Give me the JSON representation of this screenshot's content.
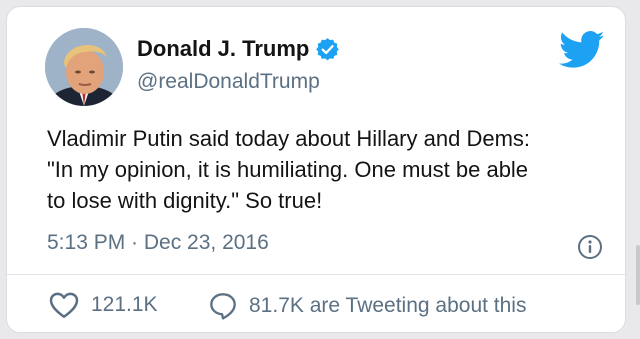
{
  "tweet": {
    "author": {
      "display_name": "Donald J. Trump",
      "handle": "@realDonaldTrump",
      "verified": true,
      "avatar_icon": "avatar-photo"
    },
    "text": "Vladimir Putin said today about Hillary and Dems:\n\"In my opinion, it is humiliating. One must be able\nto lose with dignity.\"  So true!",
    "timestamp": "5:13 PM · Dec 23, 2016",
    "likes": "121.1K",
    "tweeting_about": "81.7K are Tweeting about this"
  },
  "icons": {
    "brand": "twitter-bird-icon",
    "verified": "verified-badge-icon",
    "info": "info-icon",
    "like": "heart-icon",
    "reply": "speech-bubble-icon"
  },
  "colors": {
    "brand_blue": "#1da1f2",
    "text_primary": "#141414",
    "text_secondary": "#5b7083",
    "card_border": "#d9dde1"
  }
}
